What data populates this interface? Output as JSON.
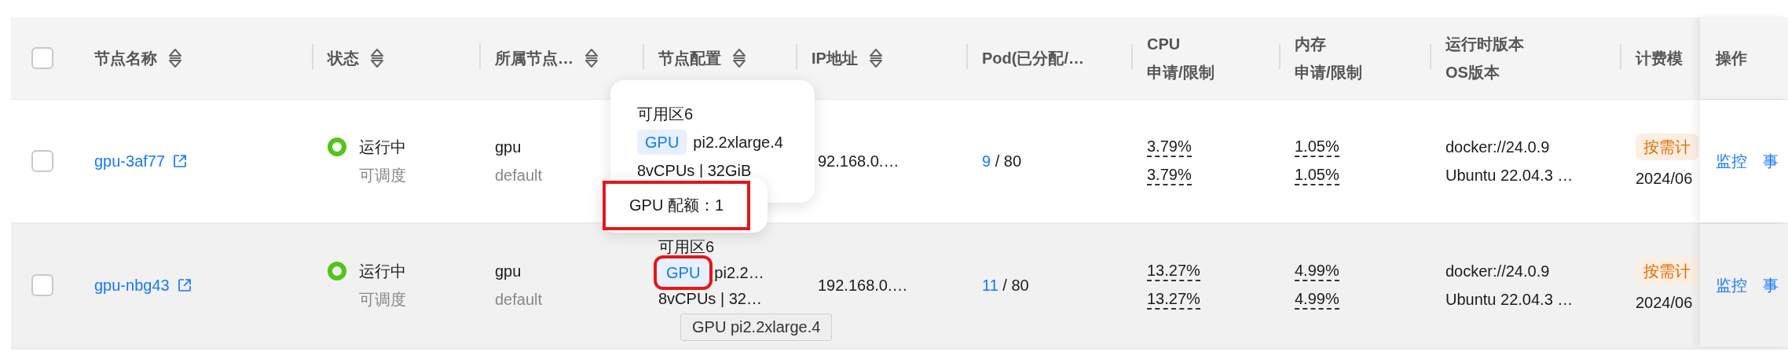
{
  "columns": [
    {
      "lines": [
        "节点名称"
      ],
      "sortable": true
    },
    {
      "lines": [
        "状态"
      ],
      "sortable": true
    },
    {
      "lines": [
        "所属节点…"
      ],
      "sortable": true
    },
    {
      "lines": [
        "节点配置"
      ],
      "sortable": true
    },
    {
      "lines": [
        "IP地址"
      ],
      "sortable": true
    },
    {
      "lines": [
        "Pod(已分配/…"
      ],
      "sortable": false
    },
    {
      "lines": [
        "CPU",
        "申请/限制"
      ],
      "sortable": false
    },
    {
      "lines": [
        "内存",
        "申请/限制"
      ],
      "sortable": false
    },
    {
      "lines": [
        "运行时版本",
        "OS版本"
      ],
      "sortable": false
    },
    {
      "lines": [
        "计费模"
      ],
      "sortable": false
    },
    {
      "lines": [
        "操作"
      ],
      "sortable": false
    }
  ],
  "header_checkbox": {
    "checked": false
  },
  "rows": [
    {
      "checked": false,
      "hovered": false,
      "name": "gpu-3af77",
      "status": {
        "text": "运行中",
        "sub": "可调度",
        "color": "#52c41a"
      },
      "group": {
        "name": "gpu",
        "sub": "default"
      },
      "ip": "92.168.0.…",
      "pod": {
        "used": "9",
        "total": " / 80"
      },
      "cpu": [
        "3.79%",
        "3.79%"
      ],
      "mem": [
        "1.05%",
        "1.05%"
      ],
      "runtime": [
        "docker://24.0.9",
        "Ubuntu 22.04.3 …"
      ],
      "billing": {
        "tag": "按需计",
        "date": "2024/06"
      },
      "actions": [
        "监控",
        "事"
      ]
    },
    {
      "checked": false,
      "hovered": true,
      "name": "gpu-nbg43",
      "status": {
        "text": "运行中",
        "sub": "可调度",
        "color": "#52c41a"
      },
      "group": {
        "name": "gpu",
        "sub": "default"
      },
      "config": {
        "zone": "可用区6",
        "tag": "GPU",
        "tag_highlight": true,
        "spec": "pi2.2…",
        "resources": "8vCPUs | 32…",
        "tooltip": "GPU pi2.2xlarge.4"
      },
      "ip": "192.168.0.…",
      "pod": {
        "used": "11",
        "total": " / 80"
      },
      "cpu": [
        "13.27%",
        "13.27%"
      ],
      "mem": [
        "4.99%",
        "4.99%"
      ],
      "runtime": [
        "docker://24.0.9",
        "Ubuntu 22.04.3 …"
      ],
      "billing": {
        "tag": "按需计",
        "date": "2024/06"
      },
      "actions": [
        "监控",
        "事"
      ]
    }
  ],
  "popovers": [
    {
      "kind": "spec",
      "zone": "可用区6",
      "tag": "GPU",
      "spec": "pi2.2xlarge.4",
      "resources": "8vCPUs | 32GiB"
    },
    {
      "kind": "quota",
      "text": "GPU 配额：1",
      "highlight": true
    }
  ]
}
